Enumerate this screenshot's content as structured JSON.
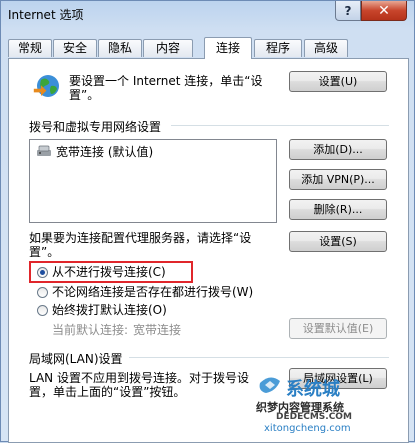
{
  "window": {
    "title": "Internet 选项",
    "help_label": "?",
    "close_label": "✕"
  },
  "tabs": [
    {
      "label": "常规"
    },
    {
      "label": "安全"
    },
    {
      "label": "隐私"
    },
    {
      "label": "内容"
    },
    {
      "label": "连接"
    },
    {
      "label": "程序"
    },
    {
      "label": "高级"
    }
  ],
  "setup": {
    "text_line1": "要设置一个 Internet 连接，单击“设",
    "text_line2": "置”。",
    "button_label": "设置(U)"
  },
  "dialup": {
    "group_label": "拨号和虚拟专用网络设置",
    "list_items": [
      {
        "label": "宽带连接 (默认值)"
      }
    ],
    "add_button": "添加(D)...",
    "add_vpn_button": "添加 VPN(P)...",
    "delete_button": "删除(R)...",
    "proxy_text_line1": "如果要为连接配置代理服务器，请选择“设",
    "proxy_text_line2": "置”。",
    "settings_button": "设置(S)",
    "radio_never": "从不进行拨号连接(C)",
    "radio_no_network": "不论网络连接是否存在都进行拨号(W)",
    "radio_always": "始终拨打默认连接(O)",
    "current_default_label": "当前默认连接:",
    "current_default_value": "宽带连接",
    "set_default_button": "设置默认值(E)"
  },
  "lan": {
    "group_label": "局域网(LAN)设置",
    "text_line1": "LAN 设置不应用到拨号连接。对于拨号设",
    "text_line2": "置，单击上面的“设置”按钮。",
    "button_label": "局域网设置(L)"
  },
  "watermark": {
    "line1": "系统城",
    "line2": "织梦内容管理系统",
    "line3": "DEDECMS.COM",
    "line4": "xitongcheng.com"
  }
}
